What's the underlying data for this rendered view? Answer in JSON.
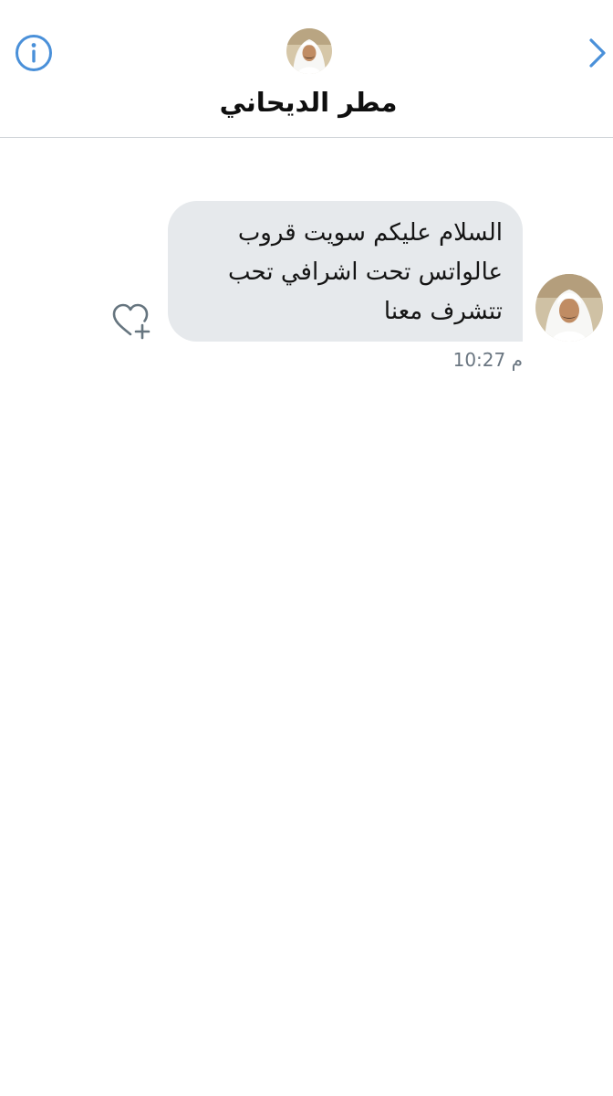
{
  "header": {
    "contact_name": "مطر الديحاني",
    "info_icon": "info-icon",
    "back_icon": "chevron-right-icon",
    "accent_color": "#4a90d9"
  },
  "conversation": {
    "messages": [
      {
        "text": "السلام عليكم سويت قروب عالواتس تحت اشرافي تحب تتشرف معنا",
        "time": "10:27 م",
        "like_icon": "heart-plus-icon"
      }
    ]
  },
  "colors": {
    "bubble_background": "#e6e9ec",
    "timestamp_color": "#6a7681",
    "divider_color": "#d0d4d8"
  }
}
